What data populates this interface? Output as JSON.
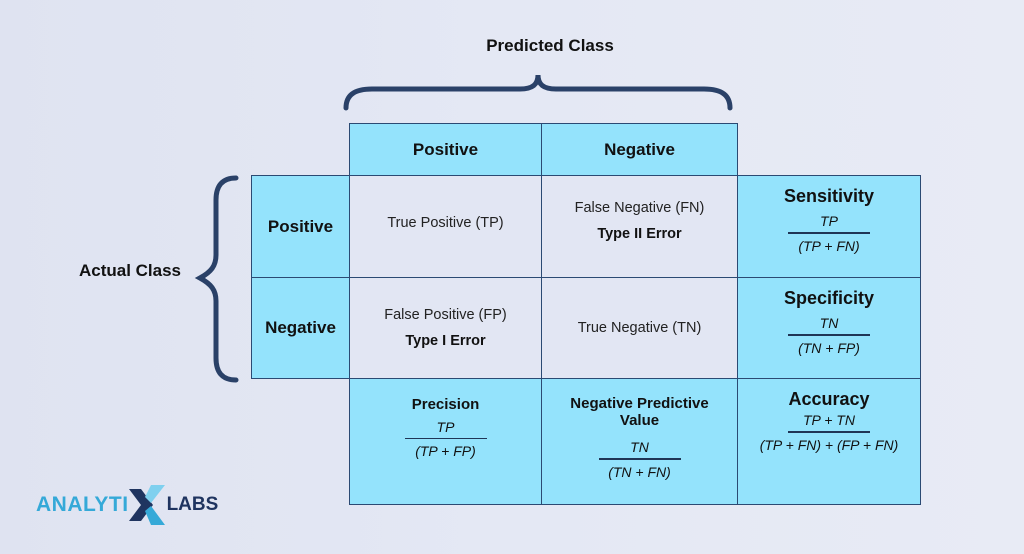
{
  "title": "Predicted Class",
  "side_label": "Actual Class",
  "predicted_headers": [
    "Positive",
    "Negative"
  ],
  "actual_headers": [
    "Positive",
    "Negative"
  ],
  "cells": {
    "tp": {
      "label": "True Positive (TP)"
    },
    "fn": {
      "label": "False Negative (FN)",
      "error": "Type II Error"
    },
    "fp": {
      "label": "False Positive (FP)",
      "error": "Type I Error"
    },
    "tn": {
      "label": "True Negative (TN)"
    }
  },
  "metrics": {
    "sensitivity": {
      "name": "Sensitivity",
      "numerator": "TP",
      "denominator": "(TP + FN)"
    },
    "specificity": {
      "name": "Specificity",
      "numerator": "TN",
      "denominator": "(TN + FP)"
    },
    "accuracy": {
      "name": "Accuracy",
      "numerator": "TP + TN",
      "denominator": "(TP + FN) + (FP + FN)"
    },
    "precision": {
      "name": "Precision",
      "numerator": "TP",
      "denominator": "(TP + FP)"
    },
    "npv": {
      "name_line1": "Negative Predictive",
      "name_line2": "Value",
      "numerator": "TN",
      "denominator": "(TN + FN)"
    }
  },
  "logo": {
    "part1": "ANALYTI",
    "part2": "LABS"
  },
  "colors": {
    "header_fill": "#94e3fc",
    "cell_fill": "#e2e6f3",
    "border": "#2b4a73",
    "brace": "#2a4168",
    "logo_light": "#35a9d8",
    "logo_dark": "#1f3460"
  }
}
